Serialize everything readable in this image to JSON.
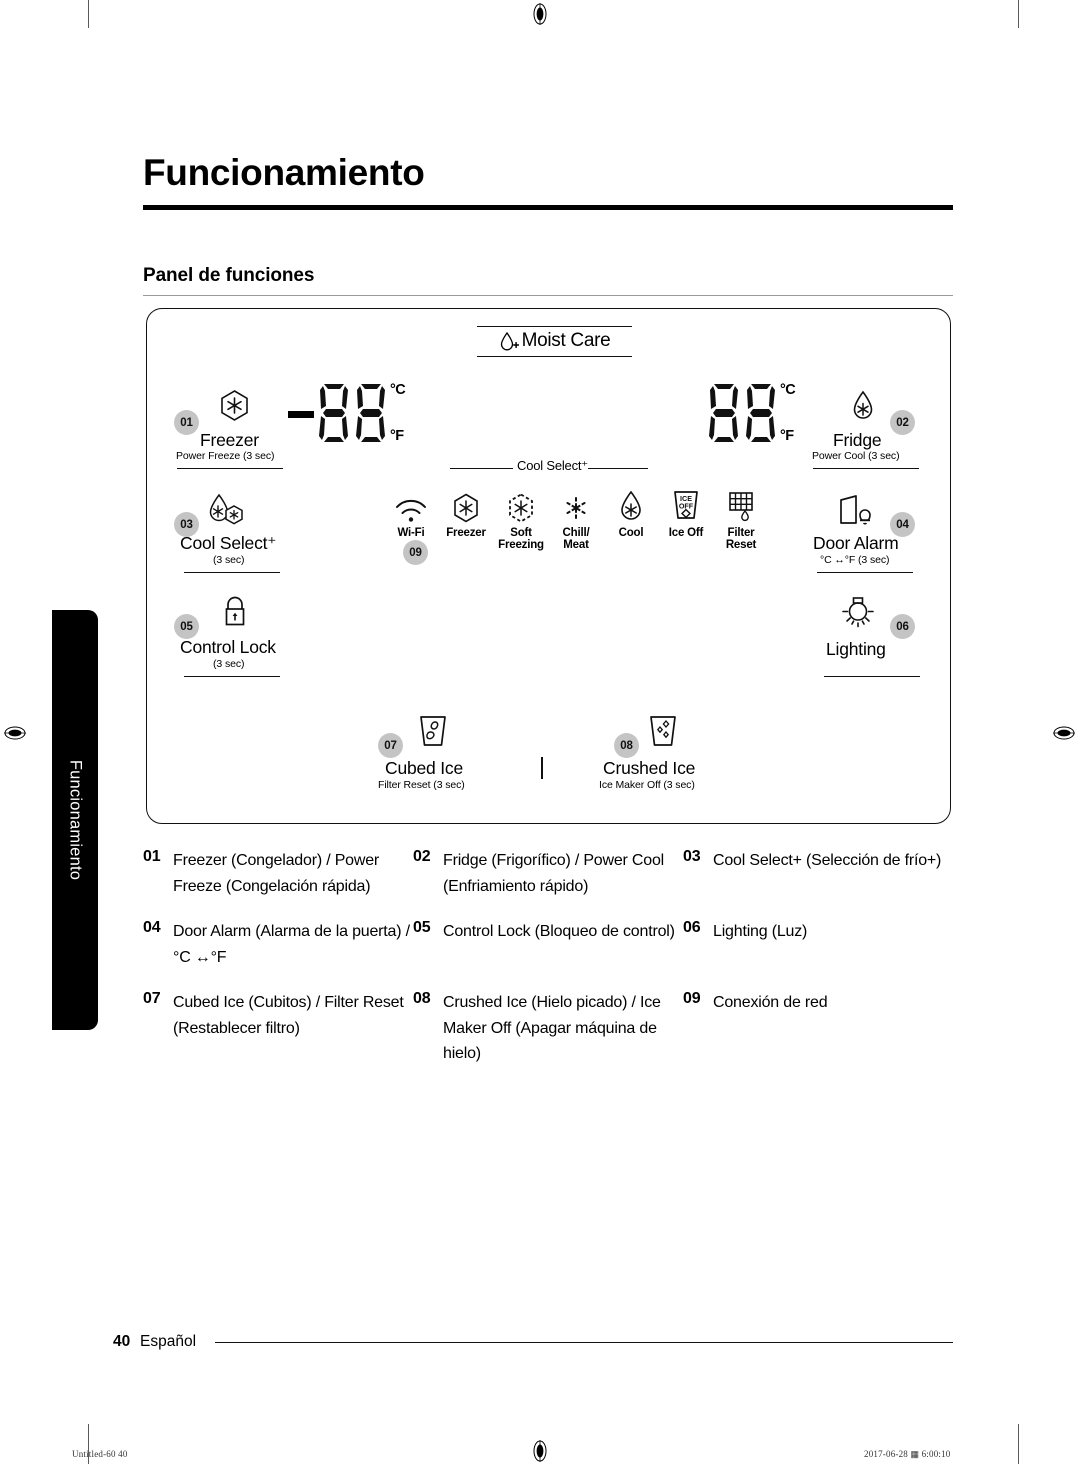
{
  "document": {
    "chapter_title": "Funcionamiento",
    "section_title": "Panel de funciones",
    "side_tab_label": "Funcionamiento"
  },
  "panel": {
    "moist_care": {
      "label": "Moist Care",
      "icon": "droplet-plus-icon"
    },
    "displays": {
      "freezer": {
        "minus": true,
        "digits": "88",
        "unit_c": "°C",
        "unit_f": "°F"
      },
      "fridge": {
        "minus": false,
        "digits": "88",
        "unit_c": "°C",
        "unit_f": "°F"
      }
    },
    "cool_select_connector": "Cool Select⁺",
    "buttons": [
      {
        "num": "01",
        "name": "Freezer",
        "sub": "Power Freeze (3 sec)",
        "icon": "hexagon-snowflake-icon"
      },
      {
        "num": "02",
        "name": "Fridge",
        "sub": "Power Cool (3 sec)",
        "icon": "droplet-snowflake-icon"
      },
      {
        "num": "03",
        "name": "Cool Select⁺",
        "sub": "(3 sec)",
        "icon": "droplet-snowflake-hexagon-icon"
      },
      {
        "num": "04",
        "name": "Door Alarm",
        "sub": "°C ↔°F (3 sec)",
        "icon": "door-bell-icon"
      },
      {
        "num": "05",
        "name": "Control Lock",
        "sub": "(3 sec)",
        "icon": "padlock-icon"
      },
      {
        "num": "06",
        "name": "Lighting",
        "sub": "",
        "icon": "lightbulb-icon"
      },
      {
        "num": "07",
        "name": "Cubed Ice",
        "sub": "Filter Reset (3 sec)",
        "icon": "cup-cubed-ice-icon"
      },
      {
        "num": "08",
        "name": "Crushed Ice",
        "sub": "Ice Maker Off (3 sec)",
        "icon": "cup-crushed-ice-icon"
      }
    ],
    "mode_icons": [
      {
        "caption": "Wi-Fi",
        "icon": "wifi-icon",
        "badge": "09"
      },
      {
        "caption": "Freezer",
        "icon": "hexagon-snowflake-icon",
        "badge": ""
      },
      {
        "caption": "Soft\nFreezing",
        "icon": "dashed-hexagon-snowflake-icon",
        "badge": ""
      },
      {
        "caption": "Chill/\nMeat",
        "icon": "dashed-asterisk-icon",
        "badge": ""
      },
      {
        "caption": "Cool",
        "icon": "droplet-snowflake-icon",
        "badge": ""
      },
      {
        "caption": "Ice Off",
        "icon": "cup-ice-off-icon",
        "badge": ""
      },
      {
        "caption": "Filter\nReset",
        "icon": "filter-grid-droplet-icon",
        "badge": ""
      }
    ],
    "ice_off_icon_text": {
      "line1": "ICE",
      "line2": "OFF"
    }
  },
  "legend": [
    [
      {
        "num": "01",
        "text": "Freezer (Congelador) / Power Freeze (Congelación rápida)"
      },
      {
        "num": "02",
        "text": "Fridge (Frigorífico) / Power Cool (Enfriamiento rápido)"
      },
      {
        "num": "03",
        "text": "Cool Select+ (Selección de frío+)"
      }
    ],
    [
      {
        "num": "04",
        "text": "Door Alarm (Alarma de la puerta) / °C ↔°F"
      },
      {
        "num": "05",
        "text": "Control Lock (Bloqueo de control)"
      },
      {
        "num": "06",
        "text": "Lighting (Luz)"
      }
    ],
    [
      {
        "num": "07",
        "text": "Cubed Ice (Cubitos) / Filter Reset (Restablecer filtro)"
      },
      {
        "num": "08",
        "text": "Crushed Ice (Hielo picado) / Ice Maker Off (Apagar máquina de hielo)"
      },
      {
        "num": "09",
        "text": "Conexión de red"
      }
    ]
  ],
  "footer": {
    "page_number": "40",
    "language": "Español"
  },
  "print_marks": {
    "left": "Untitled-60   40",
    "right": "2017-06-28   ▦ 6:00:10"
  }
}
